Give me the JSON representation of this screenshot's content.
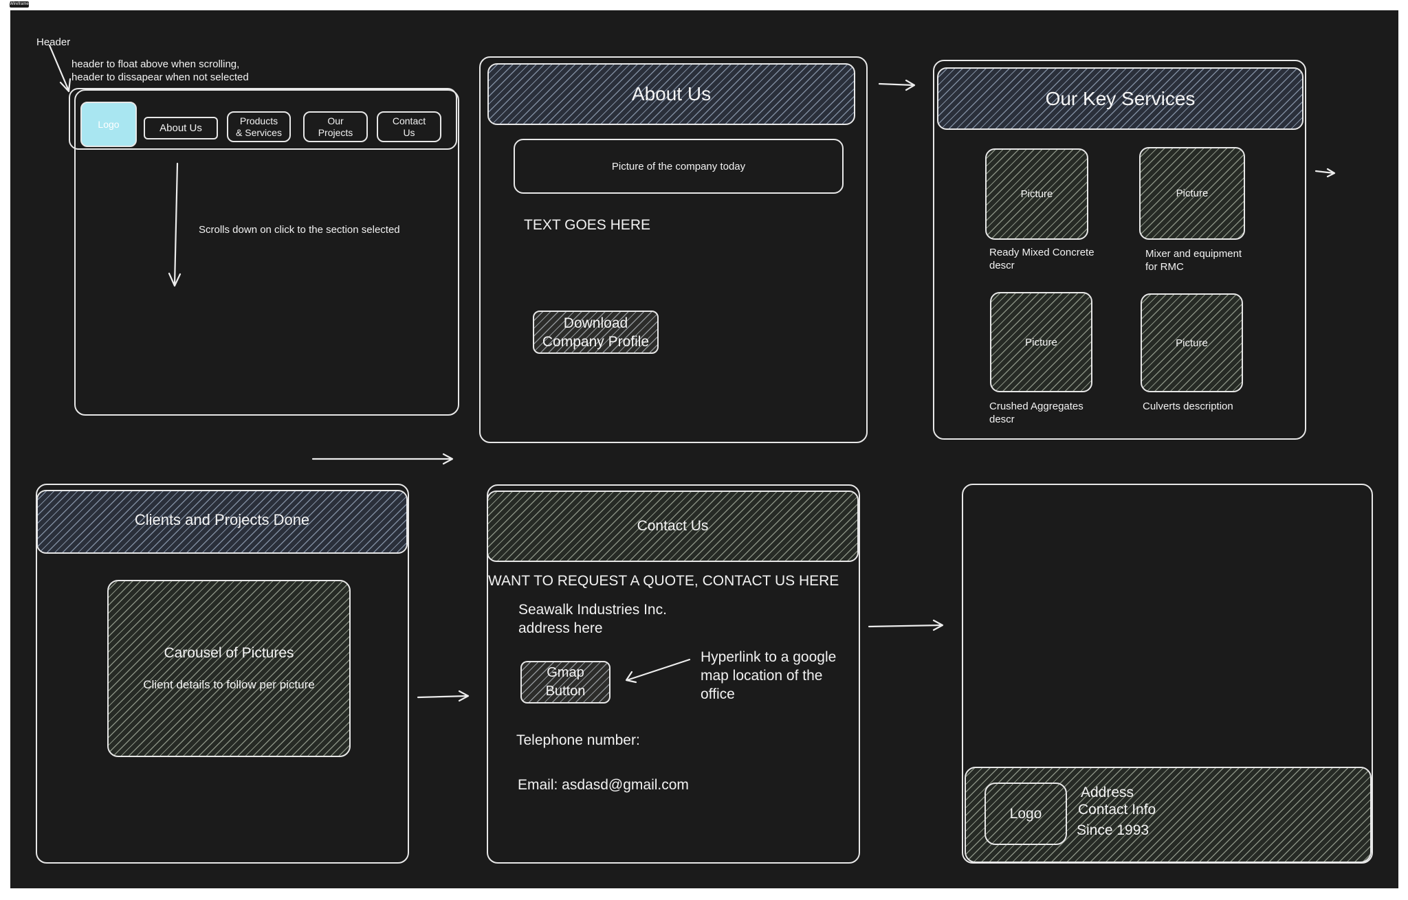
{
  "frame_tag": "Wireframe",
  "notes": {
    "header_label": "Header",
    "header_behavior": "header to float above when scrolling,\nheader to dissapear when not selected",
    "scroll_note": "Scrolls down on click to the section selected",
    "hyperlink_note": "Hyperlink to a google\nmap location of the\noffice"
  },
  "header_frame": {
    "logo": "Logo",
    "nav": [
      "About Us",
      "Products\n& Services",
      "Our\nProjects",
      "Contact\nUs"
    ]
  },
  "about": {
    "title": "About Us",
    "picture": "Picture of the company today",
    "text": "TEXT GOES HERE",
    "download_button": "Download\nCompany Profile"
  },
  "services": {
    "title": "Our Key Services",
    "items": [
      {
        "picture": "Picture",
        "caption": "Ready Mixed Concrete\ndescr"
      },
      {
        "picture": "Picture",
        "caption": "Mixer and equipment\nfor RMC"
      },
      {
        "picture": "Picture",
        "caption": "Crushed Aggregates\ndescr"
      },
      {
        "picture": "Picture",
        "caption": "Culverts description"
      }
    ]
  },
  "clients": {
    "title": "Clients and Projects Done",
    "carousel_title": "Carousel of Pictures",
    "carousel_subtitle": "Client details to follow per picture"
  },
  "contact": {
    "title": "Contact Us",
    "headline": "WANT TO REQUEST A QUOTE, CONTACT US HERE",
    "company": "Seawalk Industries Inc.\naddress here",
    "gmap_button": "Gmap\nButton",
    "telephone": "Telephone number:",
    "email": "Email: asdasd@gmail.com"
  },
  "footer": {
    "logo": "Logo",
    "address": "Address",
    "contact_info": "Contact Info",
    "since": "Since 1993"
  }
}
